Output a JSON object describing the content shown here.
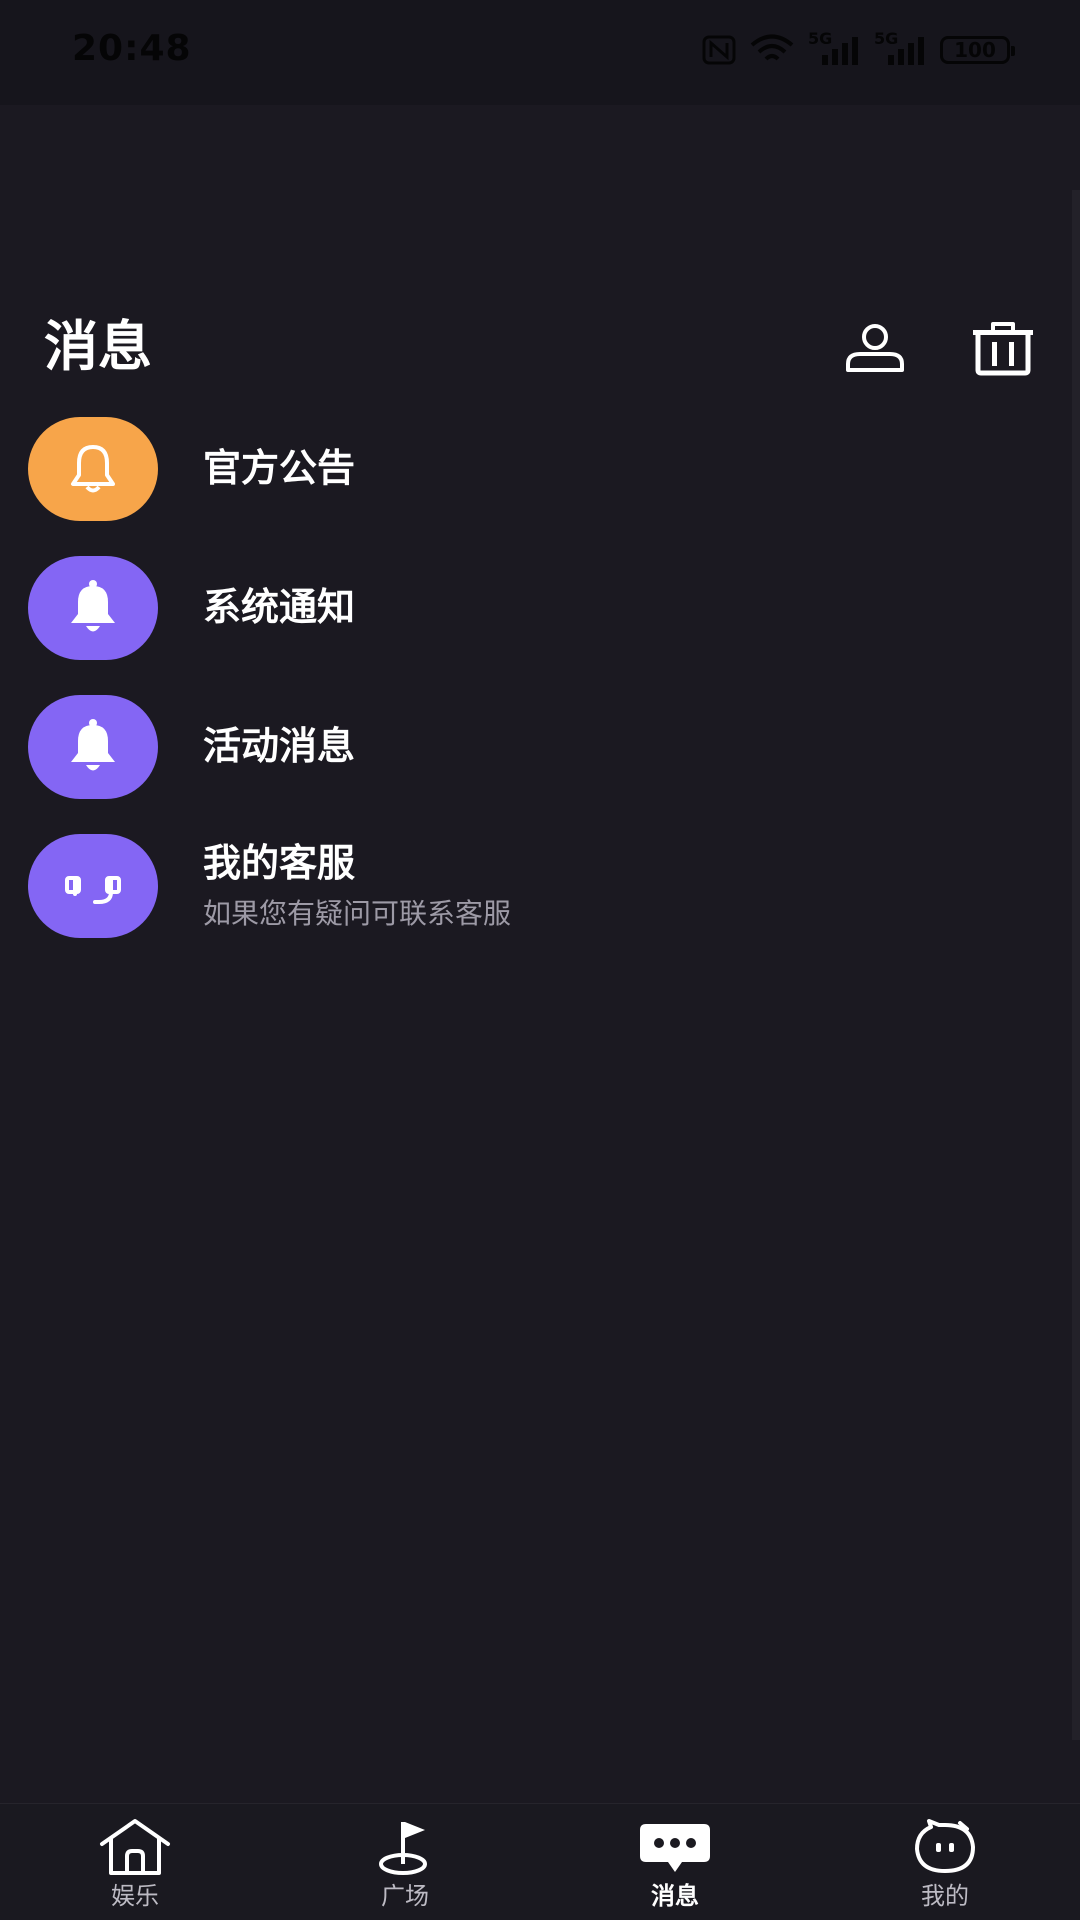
{
  "status_bar": {
    "time": "20:48",
    "network_1": "5G",
    "network_2": "5G",
    "battery": "100"
  },
  "header": {
    "title": "消息",
    "contacts_icon": "person-icon",
    "clear_icon": "trash-icon"
  },
  "messages": [
    {
      "title": "官方公告",
      "icon": "bell-outline-icon",
      "color": "#f7a54a"
    },
    {
      "title": "系统通知",
      "icon": "bell-filled-icon",
      "color": "#8466f4"
    },
    {
      "title": "活动消息",
      "icon": "bell-filled-icon",
      "color": "#8466f4"
    },
    {
      "title": "我的客服",
      "subtitle": "如果您有疑问可联系客服",
      "icon": "headset-icon",
      "color": "#8466f4"
    }
  ],
  "bottom_nav": [
    {
      "label": "娱乐",
      "icon": "home-icon"
    },
    {
      "label": "广场",
      "icon": "golf-flag-icon"
    },
    {
      "label": "消息",
      "icon": "chat-bubble-icon",
      "active": true
    },
    {
      "label": "我的",
      "icon": "face-bubble-icon"
    }
  ]
}
